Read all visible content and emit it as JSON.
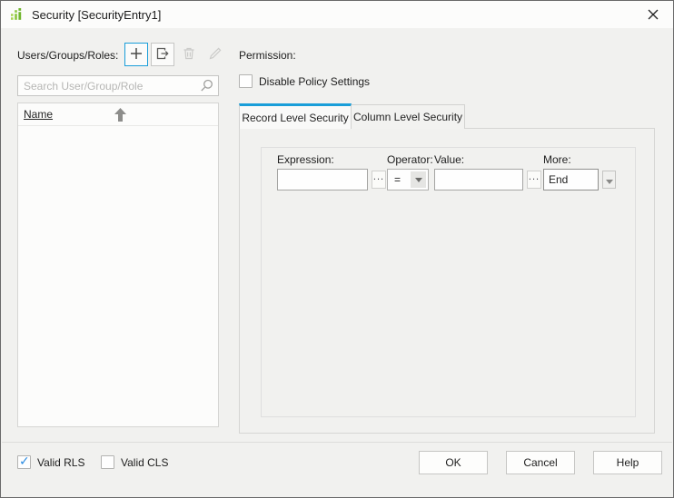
{
  "titlebar": {
    "title": "Security [SecurityEntry1]"
  },
  "left": {
    "label": "Users/Groups/Roles:",
    "toolbar": {
      "add_tooltip": "Add",
      "import_tooltip": "Import",
      "delete_tooltip": "Delete",
      "edit_tooltip": "Edit"
    },
    "search_placeholder": "Search User/Group/Role",
    "list_header": "Name",
    "list_rows": []
  },
  "right": {
    "permission_label": "Permission:",
    "disable_policy_label": "Disable Policy Settings",
    "disable_policy_checked": false,
    "tabs": [
      {
        "label": "Record Level Security",
        "active": true
      },
      {
        "label": "Column Level Security",
        "active": false
      }
    ],
    "form": {
      "expression_label": "Expression:",
      "expression_value": "",
      "browse": "...",
      "operator_label": "Operator:",
      "operator_value": "=",
      "value_label": "Value:",
      "value_value": "",
      "more_label": "More:",
      "more_value": "End"
    }
  },
  "footer": {
    "valid_rls_label": "Valid RLS",
    "valid_rls_checked": true,
    "valid_cls_label": "Valid CLS",
    "valid_cls_checked": false,
    "ok_label": "OK",
    "cancel_label": "Cancel",
    "help_label": "Help"
  },
  "icons": {
    "app": "green-bar-chart",
    "close": "x-glyph",
    "add": "plus",
    "import": "box-arrow-right",
    "delete": "trash",
    "edit": "pencil",
    "search": "magnifier",
    "sort": "arrow-up",
    "dropdown": "triangle-down",
    "check": "✓"
  },
  "colors": {
    "accent_blue": "#1a9ed9",
    "check_blue": "#2b8ce2",
    "app_green": "#8cc63f",
    "dialog_bg": "#f1f1ef",
    "panel_border": "#d6d6d4"
  }
}
